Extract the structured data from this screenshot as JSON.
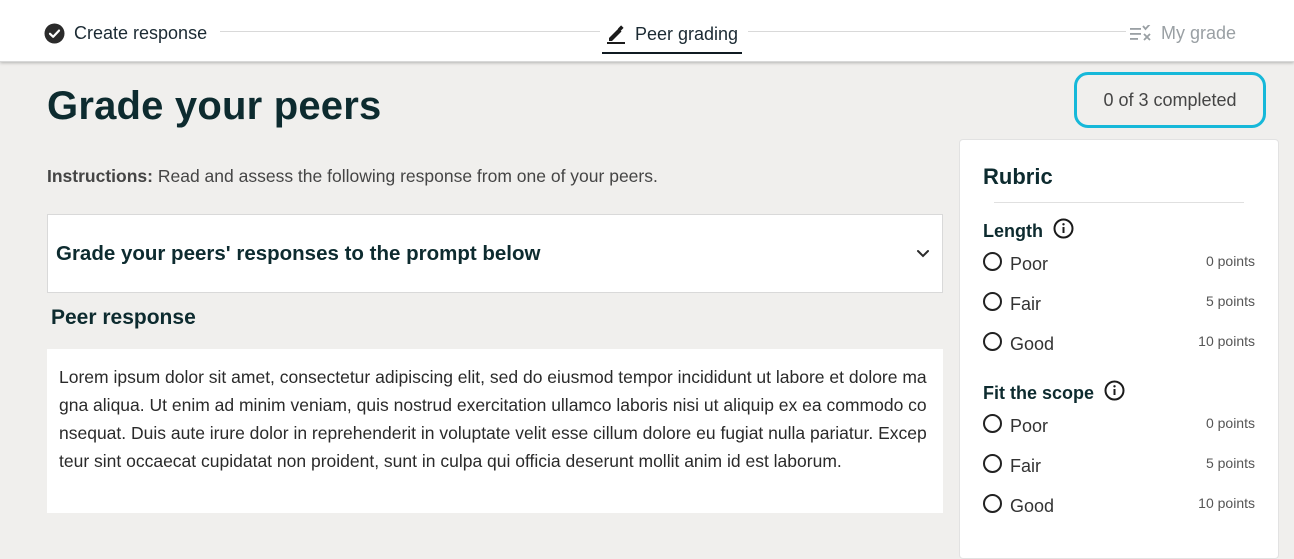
{
  "steps": {
    "create": {
      "label": "Create response",
      "icon": "check-circle-icon"
    },
    "peer": {
      "label": "Peer grading",
      "icon": "pencil-icon"
    },
    "mine": {
      "label": "My grade",
      "icon": "grade-list-icon"
    }
  },
  "page": {
    "title": "Grade your peers",
    "progress": "0 of 3 completed",
    "instructions_bold": "Instructions:",
    "instructions_text": " Read and assess the following response from one of your peers."
  },
  "prompt": {
    "title": "Grade your peers' responses to the prompt below"
  },
  "peer_response": {
    "heading": "Peer response",
    "text": "Lorem ipsum dolor sit amet, consectetur adipiscing elit, sed do eiusmod tempor incididunt ut labore et dolore magna aliqua. Ut enim ad minim veniam, quis nostrud exercitation ullamco laboris nisi ut aliquip ex ea commodo consequat. Duis aute irure dolor in reprehenderit in voluptate velit esse cillum dolore eu fugiat nulla pariatur. Excepteur sint occaecat cupidatat non proident, sunt in culpa qui officia deserunt mollit anim id est laborum."
  },
  "rubric": {
    "title": "Rubric",
    "criteria": [
      {
        "name": "Length",
        "options": [
          {
            "label": "Poor",
            "points": "0 points"
          },
          {
            "label": "Fair",
            "points": "5 points"
          },
          {
            "label": "Good",
            "points": "10 points"
          }
        ]
      },
      {
        "name": "Fit the scope",
        "options": [
          {
            "label": "Poor",
            "points": "0 points"
          },
          {
            "label": "Fair",
            "points": "5 points"
          },
          {
            "label": "Good",
            "points": "10 points"
          }
        ]
      }
    ]
  },
  "colors": {
    "accent_outline": "#16b8d9",
    "heading": "#0d2b2f",
    "background": "#f0efed"
  }
}
